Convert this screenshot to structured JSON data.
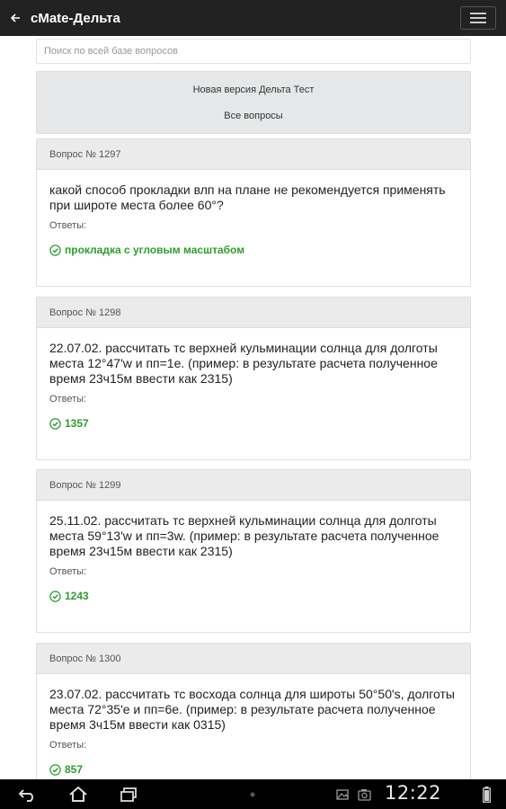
{
  "app": {
    "title": "cMate-Дельта"
  },
  "search": {
    "placeholder": "Поиск по всей базе вопросов"
  },
  "nav": {
    "new_version": "Новая версия Дельта Тест",
    "all_questions": "Все вопросы"
  },
  "answers_label": "Ответы:",
  "questions": [
    {
      "header": "Вопрос № 1297",
      "text": "какой способ прокладки влп на плане не рекомендуется применять при широте места более 60°?",
      "answer": "прокладка с угловым масштабом"
    },
    {
      "header": "Вопрос № 1298",
      "text": "22.07.02. рассчитать тс верхней кульминации солнца для долготы места 12°47'w и пп=1е. (пример: в результате расчета полученное время 23ч15м ввести как 2315)",
      "answer": "1357"
    },
    {
      "header": "Вопрос № 1299",
      "text": "25.11.02. рассчитать тс верхней кульминации солнца для долготы места 59°13'w и пп=3w. (пример: в результате расчета полученное время 23ч15м ввести как 2315)",
      "answer": "1243"
    },
    {
      "header": "Вопрос № 1300",
      "text": "23.07.02. рассчитать тс восхода солнца для широты 50°50's, долготы места 72°35'е и пп=6е. (пример: в результате расчета полученное время 3ч15м ввести как 0315)",
      "answer": "857"
    }
  ],
  "status_bar": {
    "time": "12:22"
  },
  "icons": {
    "back": "back-arrow-icon",
    "menu": "hamburger-menu-icon",
    "check": "check-circle-icon",
    "nav_back": "nav-back-icon",
    "nav_home": "nav-home-icon",
    "nav_recent": "nav-recent-apps-icon",
    "gallery": "gallery-notification-icon",
    "camera": "camera-notification-icon",
    "battery": "battery-icon"
  },
  "colors": {
    "appbar": "#222222",
    "answer_green": "#2e9e2e",
    "card_header": "#ebebeb",
    "nav_box": "#e6e7e8"
  }
}
